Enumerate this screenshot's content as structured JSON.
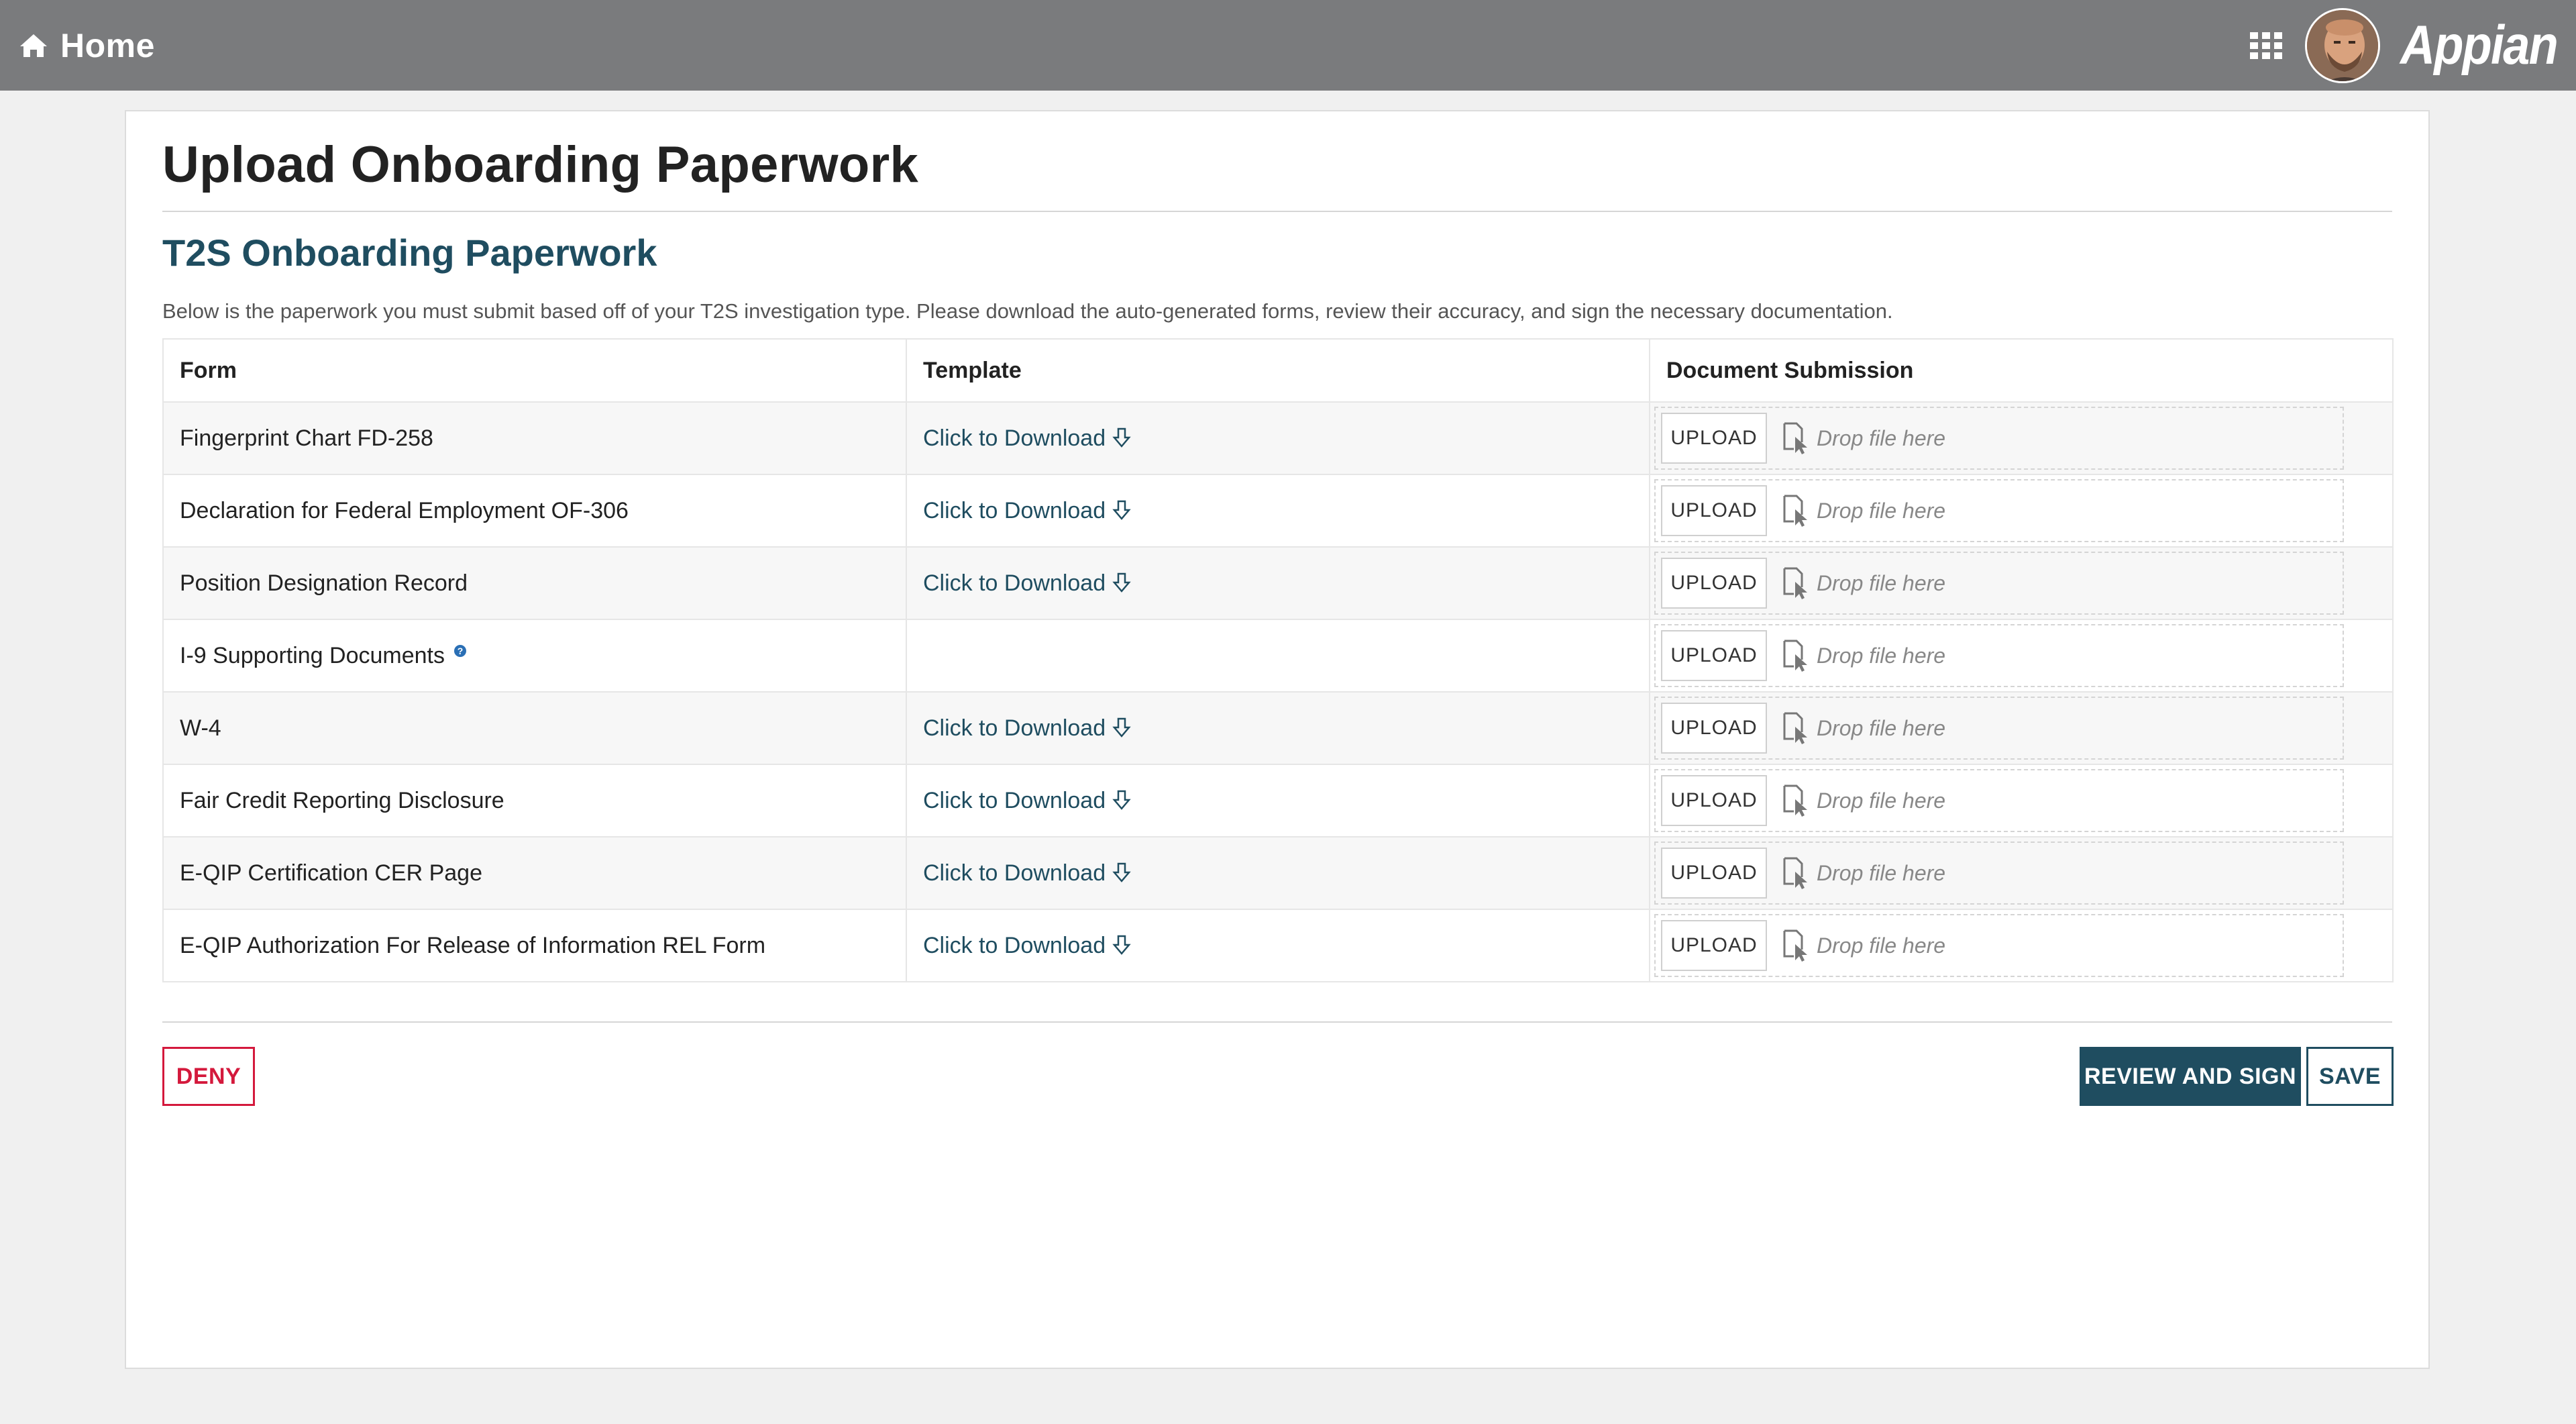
{
  "topbar": {
    "home_label": "Home",
    "brand": "Appian",
    "bg_color": "#7a7b7d"
  },
  "page": {
    "title": "Upload Onboarding Paperwork",
    "section_title": "T2S Onboarding Paperwork",
    "intro": "Below is the paperwork you must submit based off of your T2S investigation type. Please download the auto-generated forms, review their accuracy, and sign the necessary documentation."
  },
  "table": {
    "headers": {
      "form": "Form",
      "template": "Template",
      "submission": "Document Submission"
    },
    "rows": [
      {
        "form": "Fingerprint Chart FD-258",
        "template": "Click to Download",
        "upload": "UPLOAD",
        "drop": "Drop file here"
      },
      {
        "form": "Declaration for Federal Employment OF-306",
        "template": "Click to Download",
        "upload": "UPLOAD",
        "drop": "Drop file here"
      },
      {
        "form": "Position Designation Record",
        "template": "Click to Download",
        "upload": "UPLOAD",
        "drop": "Drop file here"
      },
      {
        "form": "I-9 Supporting Documents",
        "template": "",
        "help": "?",
        "upload": "UPLOAD",
        "drop": "Drop file here"
      },
      {
        "form": "W-4",
        "template": "Click to Download",
        "upload": "UPLOAD",
        "drop": "Drop file here"
      },
      {
        "form": "Fair Credit Reporting Disclosure",
        "template": "Click to Download",
        "upload": "UPLOAD",
        "drop": "Drop file here"
      },
      {
        "form": "E-QIP Certification CER Page",
        "template": "Click to Download",
        "upload": "UPLOAD",
        "drop": "Drop file here"
      },
      {
        "form": "E-QIP Authorization For Release of Information REL Form",
        "template": "Click to Download",
        "upload": "UPLOAD",
        "drop": "Drop file here"
      }
    ]
  },
  "actions": {
    "deny": "DENY",
    "review": "REVIEW AND SIGN",
    "save": "SAVE"
  },
  "colors": {
    "accent": "#1f4d60",
    "deny": "#d4193c",
    "help": "#2a6fb5"
  }
}
